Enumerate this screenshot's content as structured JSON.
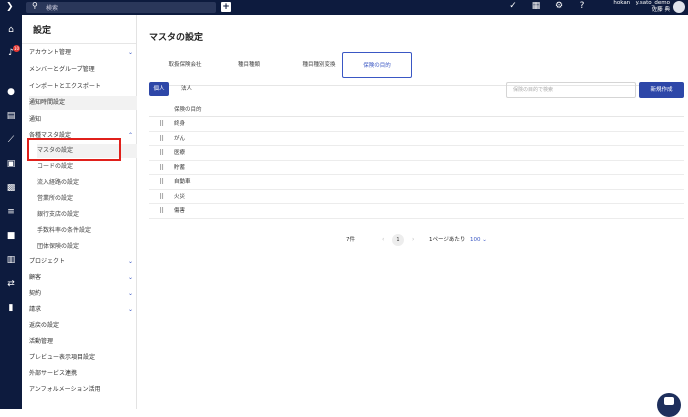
{
  "topbar": {
    "search_placeholder": "検索",
    "user_line1": "hokan　y.sato_demo",
    "user_line2": "佐藤 典"
  },
  "rail": {
    "notification_count": "10"
  },
  "sidebar": {
    "title": "設定",
    "items": [
      {
        "label": "アカウント管理",
        "chevron": "⌄"
      },
      {
        "label": "メンバーとグループ管理"
      },
      {
        "label": "インポートとエクスポート"
      },
      {
        "label": "通知時間設定"
      },
      {
        "label": "通知"
      },
      {
        "label": "各種マスタ設定",
        "chevron": "⌃"
      },
      {
        "label": "マスタの設定"
      },
      {
        "label": "コードの設定"
      },
      {
        "label": "流入経路の設定"
      },
      {
        "label": "営業所の設定"
      },
      {
        "label": "銀行支店の設定"
      },
      {
        "label": "手数料率の条件設定"
      },
      {
        "label": "団体保険の設定"
      },
      {
        "label": "プロジェクト",
        "chevron": "⌄"
      },
      {
        "label": "顧客",
        "chevron": "⌄"
      },
      {
        "label": "契約",
        "chevron": "⌄"
      },
      {
        "label": "請求",
        "chevron": "⌄"
      },
      {
        "label": "返戻の設定"
      },
      {
        "label": "活動管理"
      },
      {
        "label": "プレビュー表示項目設定"
      },
      {
        "label": "外部サービス連携"
      },
      {
        "label": "アンフォルメーション活用"
      }
    ]
  },
  "main": {
    "title": "マスタの設定",
    "tabs": [
      {
        "label": "取扱保険会社"
      },
      {
        "label": "種目種類"
      },
      {
        "label": "種目種別変換"
      },
      {
        "label": "保険の目的"
      }
    ],
    "btn_individual": "個人",
    "btn_corporate": "法人",
    "filter_placeholder": "保険の目的で検索",
    "btn_new": "新規作成",
    "table": {
      "header": "保険の目的",
      "rows": [
        "終身",
        "がん",
        "医療",
        "貯蓄",
        "自動車",
        "火災",
        "傷害"
      ]
    },
    "pager": {
      "count": "7件",
      "current_page": "1",
      "per_page_label": "1ページあたり",
      "per_page": "100 ⌄"
    }
  }
}
